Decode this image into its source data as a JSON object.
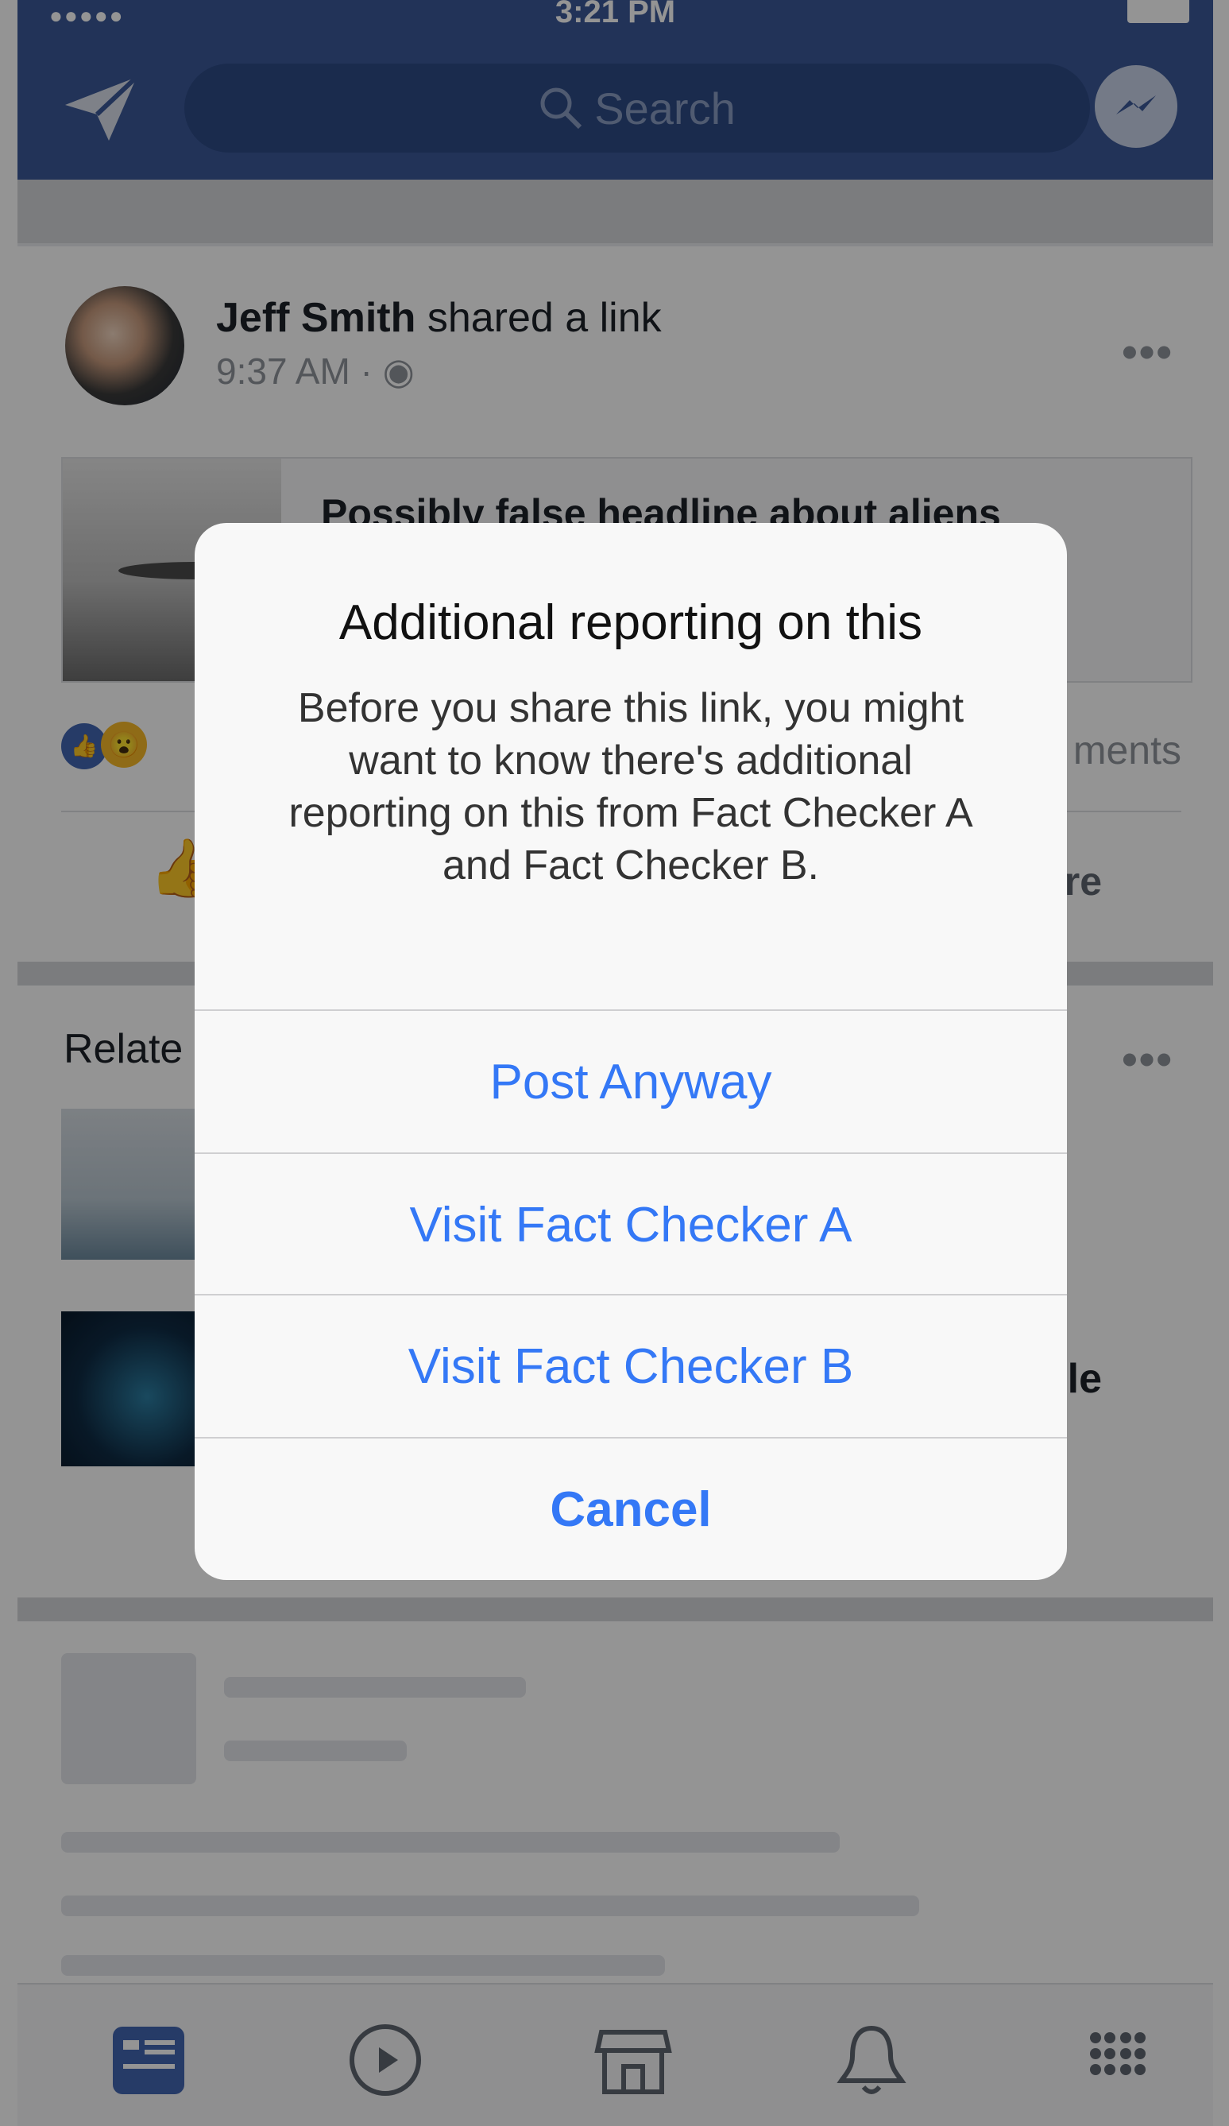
{
  "status_bar": {
    "signal": "●●●●● ",
    "time": "3:21 PM"
  },
  "header": {
    "search_placeholder": "Search"
  },
  "post": {
    "author": "Jeff Smith",
    "action": " shared a link",
    "time": "9:37 AM · ",
    "more": "•••",
    "link_title": "Possibly false headline about aliens",
    "comments_partial": "ments",
    "share_partial": "are"
  },
  "related": {
    "label_partial": "Relate",
    "more": "•••",
    "item2_partial": "le"
  },
  "dialog": {
    "title": "Additional reporting on this",
    "message": "Before you share this link, you might want to know there's additional reporting on this from Fact Checker A and Fact Checker B.",
    "buttons": {
      "post_anyway": "Post Anyway",
      "visit_a": "Visit Fact Checker A",
      "visit_b": "Visit Fact Checker B",
      "cancel": "Cancel"
    }
  },
  "colors": {
    "brand": "#3b5998",
    "ios_blue": "#3478f6"
  },
  "icons": [
    "share-icon",
    "search-icon",
    "messenger-icon",
    "globe-icon",
    "like-reaction-icon",
    "wow-reaction-icon",
    "like-icon",
    "news-feed-icon",
    "watch-icon",
    "marketplace-icon",
    "notifications-icon",
    "menu-icon"
  ]
}
